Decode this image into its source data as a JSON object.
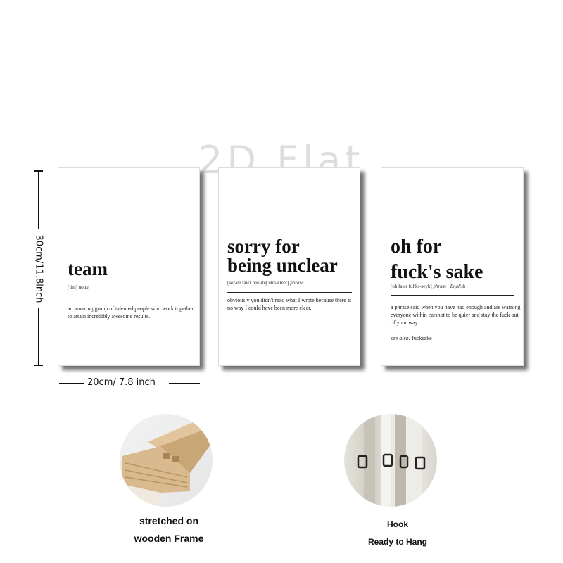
{
  "watermark": "2D Flat",
  "prints": [
    {
      "word": "team",
      "pronunciation": "[tim]",
      "part_of_speech": "noun",
      "definition": "an amazing group of talented people who work together to attain incredibly awesome results."
    },
    {
      "word": "sorry for\nbeing unclear",
      "pronunciation": "[sor-ee fawr bee-ing uhn-kleer]",
      "part_of_speech": "phrase",
      "definition": "obviously you didn't read what I wrote because there is no way I could have been more clear."
    },
    {
      "word": "oh for\nfuck's sake",
      "pronunciation": "[oh fawr fuhks-seyk]",
      "part_of_speech": "phrase · English",
      "definition": "a phrase said when you have had enough and are warning everyone within earshot to be quier and stay the fuck out of your way.",
      "see_also_label": "see also:",
      "see_also_value": "fucksake"
    }
  ],
  "dimensions": {
    "height_label": "30cm/11.8inch",
    "width_label": "20cm/ 7.8 inch"
  },
  "features": {
    "frame_caption_line1": "stretched on",
    "frame_caption_line2": "wooden Frame",
    "hook_caption_line1": "Hook",
    "hook_caption_line2": "Ready to Hang"
  },
  "colors": {
    "background": "#ffffff",
    "ink": "#111111",
    "wood": "#d9b98e"
  }
}
